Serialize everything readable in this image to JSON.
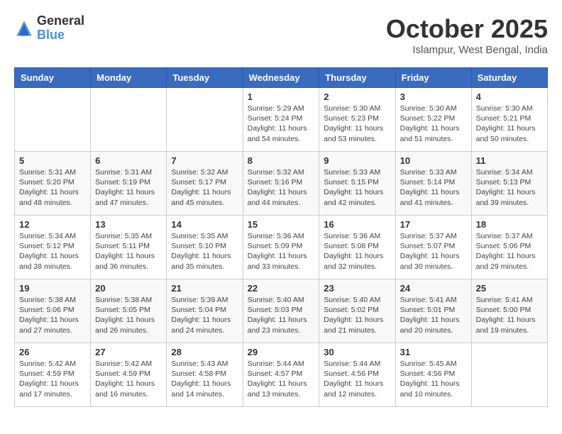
{
  "header": {
    "logo_general": "General",
    "logo_blue": "Blue",
    "month_title": "October 2025",
    "location": "Islampur, West Bengal, India"
  },
  "days_of_week": [
    "Sunday",
    "Monday",
    "Tuesday",
    "Wednesday",
    "Thursday",
    "Friday",
    "Saturday"
  ],
  "weeks": [
    [
      {
        "day": "",
        "info": ""
      },
      {
        "day": "",
        "info": ""
      },
      {
        "day": "",
        "info": ""
      },
      {
        "day": "1",
        "info": "Sunrise: 5:29 AM\nSunset: 5:24 PM\nDaylight: 11 hours\nand 54 minutes."
      },
      {
        "day": "2",
        "info": "Sunrise: 5:30 AM\nSunset: 5:23 PM\nDaylight: 11 hours\nand 53 minutes."
      },
      {
        "day": "3",
        "info": "Sunrise: 5:30 AM\nSunset: 5:22 PM\nDaylight: 11 hours\nand 51 minutes."
      },
      {
        "day": "4",
        "info": "Sunrise: 5:30 AM\nSunset: 5:21 PM\nDaylight: 11 hours\nand 50 minutes."
      }
    ],
    [
      {
        "day": "5",
        "info": "Sunrise: 5:31 AM\nSunset: 5:20 PM\nDaylight: 11 hours\nand 48 minutes."
      },
      {
        "day": "6",
        "info": "Sunrise: 5:31 AM\nSunset: 5:19 PM\nDaylight: 11 hours\nand 47 minutes."
      },
      {
        "day": "7",
        "info": "Sunrise: 5:32 AM\nSunset: 5:17 PM\nDaylight: 11 hours\nand 45 minutes."
      },
      {
        "day": "8",
        "info": "Sunrise: 5:32 AM\nSunset: 5:16 PM\nDaylight: 11 hours\nand 44 minutes."
      },
      {
        "day": "9",
        "info": "Sunrise: 5:33 AM\nSunset: 5:15 PM\nDaylight: 11 hours\nand 42 minutes."
      },
      {
        "day": "10",
        "info": "Sunrise: 5:33 AM\nSunset: 5:14 PM\nDaylight: 11 hours\nand 41 minutes."
      },
      {
        "day": "11",
        "info": "Sunrise: 5:34 AM\nSunset: 5:13 PM\nDaylight: 11 hours\nand 39 minutes."
      }
    ],
    [
      {
        "day": "12",
        "info": "Sunrise: 5:34 AM\nSunset: 5:12 PM\nDaylight: 11 hours\nand 38 minutes."
      },
      {
        "day": "13",
        "info": "Sunrise: 5:35 AM\nSunset: 5:11 PM\nDaylight: 11 hours\nand 36 minutes."
      },
      {
        "day": "14",
        "info": "Sunrise: 5:35 AM\nSunset: 5:10 PM\nDaylight: 11 hours\nand 35 minutes."
      },
      {
        "day": "15",
        "info": "Sunrise: 5:36 AM\nSunset: 5:09 PM\nDaylight: 11 hours\nand 33 minutes."
      },
      {
        "day": "16",
        "info": "Sunrise: 5:36 AM\nSunset: 5:08 PM\nDaylight: 11 hours\nand 32 minutes."
      },
      {
        "day": "17",
        "info": "Sunrise: 5:37 AM\nSunset: 5:07 PM\nDaylight: 11 hours\nand 30 minutes."
      },
      {
        "day": "18",
        "info": "Sunrise: 5:37 AM\nSunset: 5:06 PM\nDaylight: 11 hours\nand 29 minutes."
      }
    ],
    [
      {
        "day": "19",
        "info": "Sunrise: 5:38 AM\nSunset: 5:06 PM\nDaylight: 11 hours\nand 27 minutes."
      },
      {
        "day": "20",
        "info": "Sunrise: 5:38 AM\nSunset: 5:05 PM\nDaylight: 11 hours\nand 26 minutes."
      },
      {
        "day": "21",
        "info": "Sunrise: 5:39 AM\nSunset: 5:04 PM\nDaylight: 11 hours\nand 24 minutes."
      },
      {
        "day": "22",
        "info": "Sunrise: 5:40 AM\nSunset: 5:03 PM\nDaylight: 11 hours\nand 23 minutes."
      },
      {
        "day": "23",
        "info": "Sunrise: 5:40 AM\nSunset: 5:02 PM\nDaylight: 11 hours\nand 21 minutes."
      },
      {
        "day": "24",
        "info": "Sunrise: 5:41 AM\nSunset: 5:01 PM\nDaylight: 11 hours\nand 20 minutes."
      },
      {
        "day": "25",
        "info": "Sunrise: 5:41 AM\nSunset: 5:00 PM\nDaylight: 11 hours\nand 19 minutes."
      }
    ],
    [
      {
        "day": "26",
        "info": "Sunrise: 5:42 AM\nSunset: 4:59 PM\nDaylight: 11 hours\nand 17 minutes."
      },
      {
        "day": "27",
        "info": "Sunrise: 5:42 AM\nSunset: 4:59 PM\nDaylight: 11 hours\nand 16 minutes."
      },
      {
        "day": "28",
        "info": "Sunrise: 5:43 AM\nSunset: 4:58 PM\nDaylight: 11 hours\nand 14 minutes."
      },
      {
        "day": "29",
        "info": "Sunrise: 5:44 AM\nSunset: 4:57 PM\nDaylight: 11 hours\nand 13 minutes."
      },
      {
        "day": "30",
        "info": "Sunrise: 5:44 AM\nSunset: 4:56 PM\nDaylight: 11 hours\nand 12 minutes."
      },
      {
        "day": "31",
        "info": "Sunrise: 5:45 AM\nSunset: 4:56 PM\nDaylight: 11 hours\nand 10 minutes."
      },
      {
        "day": "",
        "info": ""
      }
    ]
  ]
}
